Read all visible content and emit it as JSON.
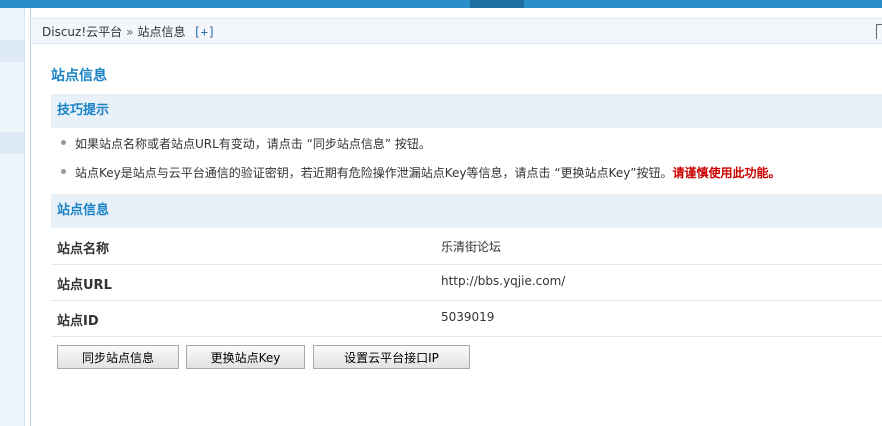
{
  "breadcrumb": {
    "root": "Discuz!云平台",
    "separator": "»",
    "current": "站点信息",
    "expand": "[+]"
  },
  "page": {
    "title": "站点信息"
  },
  "tips": {
    "heading": "技巧提示",
    "items": [
      {
        "text": "如果站点名称或者站点URL有变动，请点击 “同步站点信息” 按钮。",
        "warning": ""
      },
      {
        "text": "站点Key是站点与云平台通信的验证密钥，若近期有危险操作泄漏站点Key等信息，请点击 “更换站点Key”按钮。",
        "warning": "请谨慎使用此功能。"
      }
    ]
  },
  "site_info": {
    "heading": "站点信息",
    "rows": [
      {
        "label": "站点名称",
        "value": "乐清街论坛"
      },
      {
        "label": "站点URL",
        "value": "http://bbs.yqjie.com/"
      },
      {
        "label": "站点ID",
        "value": "5039019"
      }
    ]
  },
  "buttons": {
    "sync": "同步站点信息",
    "change_key": "更换站点Key",
    "set_ip": "设置云平台接口IP"
  },
  "colors": {
    "accent": "#1a83c6",
    "topbar": "#2a8ec9",
    "warning": "#cc0000",
    "section_bg": "#e8f0f8"
  }
}
